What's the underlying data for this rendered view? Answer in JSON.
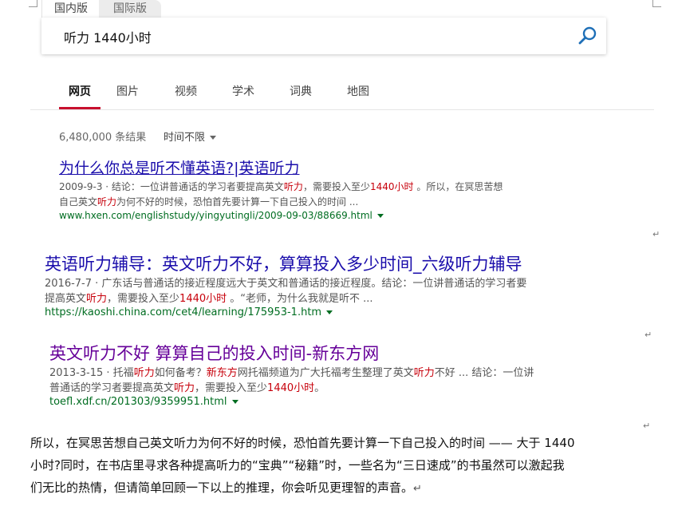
{
  "scope_tabs": [
    "国内版",
    "国际版"
  ],
  "search": {
    "query": "听力 1440小时"
  },
  "nav_tabs": [
    "网页",
    "图片",
    "视频",
    "学术",
    "词典",
    "地图"
  ],
  "result_stats": "6,480,000 条结果",
  "time_filter": "时间不限",
  "results": [
    {
      "title": "为什么你总是听不懂英语?|英语听力",
      "snippet_line1": [
        "2009-9-3 · 结论：一位讲普通话的学习者要提高英文",
        "听力",
        "，需要投入至少",
        "1440小时",
        " 。所以，在冥思苦想"
      ],
      "snippet_line2": [
        "自己英文",
        "听力",
        "为何不好的时候，恐怕首先要计算一下自己投入的时间 ..."
      ],
      "url": "www.hxen.com/englishstudy/yingyutingli/2009-09-03/88669.html"
    },
    {
      "title": "英语听力辅导：英文听力不好，算算投入多少时间_六级听力辅导",
      "snippet_line1": [
        "2016-7-7 · 广东话与普通话的接近程度远大于英文和普通话的接近程度。结论：一位讲普通话的学习者要"
      ],
      "snippet_line2": [
        "提高英文",
        "听力",
        "，需要投入至少",
        "1440小时",
        " 。“老师，为什么我就是听不 ..."
      ],
      "url": "https://kaoshi.china.com/cet4/learning/175953-1.htm"
    },
    {
      "title": "英文听力不好 算算自己的投入时间-新东方网",
      "snippet_line1": [
        "2013-3-15 · 托福",
        "听力",
        "如何备考？",
        "新东方",
        "网托福频道为广大托福考生整理了英文",
        "听力",
        "不好 ... 结论：一位讲"
      ],
      "snippet_line2": [
        "普通话的学习者要提高英文",
        "听力",
        "，需要投入至少",
        "1440小时",
        "。"
      ],
      "url": "toefl.xdf.cn/201303/9359951.html"
    }
  ],
  "doc_paragraph": [
    "所以，在冥思苦想自己英文听力为何不好的时候，恐怕首先要计算一下自己投入的时间 —— 大于 1440",
    "小时?同时，在书店里寻求各种提高听力的“宝典”“秘籍”时，一些名为“三日速成”的书虽然可以激起我",
    "们无比的热情，但请简单回顾一下以上的推理，你会听见更理智的声音。"
  ],
  "colors": {
    "link": "#1a0dab",
    "visited": "#660099",
    "url": "#006d21",
    "highlight": "#c7000b",
    "active_tab": "#c8102e"
  }
}
